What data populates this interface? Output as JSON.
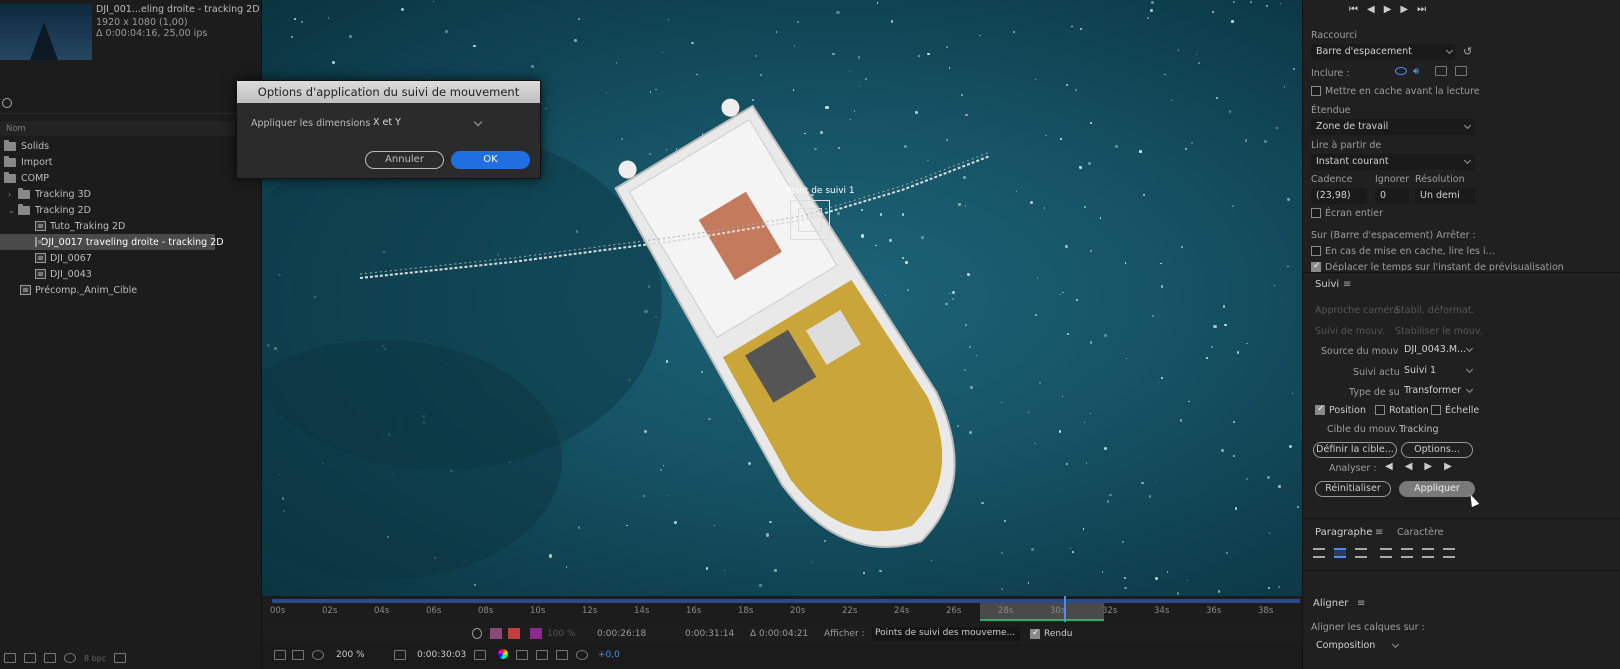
{
  "project": {
    "footage_name": "DJI_001...eling droite - tracking 2D ▾",
    "resolution": "1920 x 1080 (1,00)",
    "duration": "Δ 0:00:04:16, 25,00 ips",
    "column_name": "Nom",
    "items": [
      {
        "label": "Solids",
        "type": "folder",
        "indent": 0
      },
      {
        "label": "Import",
        "type": "folder",
        "indent": 0
      },
      {
        "label": "COMP",
        "type": "folder",
        "indent": 0
      },
      {
        "label": "Tracking 3D",
        "type": "folder",
        "indent": 1
      },
      {
        "label": "Tracking 2D",
        "type": "folder",
        "indent": 1
      },
      {
        "label": "Tuto_Traking 2D",
        "type": "comp",
        "indent": 2
      },
      {
        "label": "DJI_0017 traveling droite - tracking 2D",
        "type": "comp",
        "indent": 2
      },
      {
        "label": "DJI_0067",
        "type": "comp",
        "indent": 2
      },
      {
        "label": "DJI_0043",
        "type": "comp",
        "indent": 2
      },
      {
        "label": "Précomp._Anim_Cible",
        "type": "comp",
        "indent": 1
      }
    ],
    "bpc": "8 bpc"
  },
  "viewer": {
    "track_point_label": "Point de suivi 1"
  },
  "dialog": {
    "title": "Options d'application du suivi de mouvement",
    "dimensions_label": "Appliquer les dimensions :",
    "dimensions_value": "X et Y",
    "cancel_label": "Annuler",
    "ok_label": "OK"
  },
  "timeline": {
    "ticks": [
      "00s",
      "02s",
      "04s",
      "06s",
      "08s",
      "10s",
      "12s",
      "14s",
      "16s",
      "18s",
      "20s",
      "22s",
      "24s",
      "26s",
      "28s",
      "30s",
      "32s",
      "34s",
      "36s",
      "38s"
    ],
    "zoom_pct": "100 %",
    "in_point": "0:00:26:18",
    "out_point": "0:00:31:14",
    "duration": "Δ 0:00:04:21",
    "afficher_label": "Afficher :",
    "afficher_value": "Points de suivi des mouveme...",
    "rendu_label": "Rendu",
    "magnification": "200 %",
    "current_time": "0:00:30:03",
    "exposure": "+0,0"
  },
  "preview": {
    "raccourci_label": "Raccourci",
    "raccourci_value": "Barre d'espacement",
    "inclure_label": "Inclure :",
    "cache_label": "Mettre en cache avant la lecture",
    "etendue_label": "Étendue",
    "etendue_value": "Zone de travail",
    "lire_label": "Lire à partir de",
    "lire_value": "Instant courant",
    "cadence_label": "Cadence",
    "ignorer_label": "Ignorer",
    "resolution_label": "Résolution",
    "cadence_value": "(23,98)",
    "ignorer_value": "0",
    "resolution_value": "Un demi",
    "ecran_label": "Écran entier",
    "sur_label": "Sur (Barre d'espacement) Arrêter :",
    "en_cas_label": "En cas de mise en cache, lire les i...",
    "deplacer_label": "Déplacer le temps sur l'instant de prévisualisation"
  },
  "suivi": {
    "title": "Suivi",
    "approche_camera": "Approche caméra",
    "stabil_deformat": "Stabil. déformat.",
    "suivi_mouv": "Suivi de mouv.",
    "stabiliser_mouv": "Stabiliser le mouv.",
    "source_label": "Source du mouv. :",
    "source_value": "DJI_0043.M...",
    "actuel_label": "Suivi actuel :",
    "actuel_value": "Suivi 1",
    "type_label": "Type de suivi :",
    "type_value": "Transformer",
    "position_label": "Position",
    "rotation_label": "Rotation",
    "echelle_label": "Échelle",
    "cible_label": "Cible du mouv. :",
    "cible_value": "Tracking",
    "definir_label": "Définir la cible...",
    "options_label": "Options...",
    "analyser_label": "Analyser :",
    "reinit_label": "Réinitialiser",
    "appliquer_label": "Appliquer"
  },
  "paragraphe": {
    "tab1": "Paragraphe",
    "tab2": "Caractère"
  },
  "aligner": {
    "title": "Aligner",
    "align_label": "Aligner les calques sur :",
    "align_value": "Composition"
  }
}
